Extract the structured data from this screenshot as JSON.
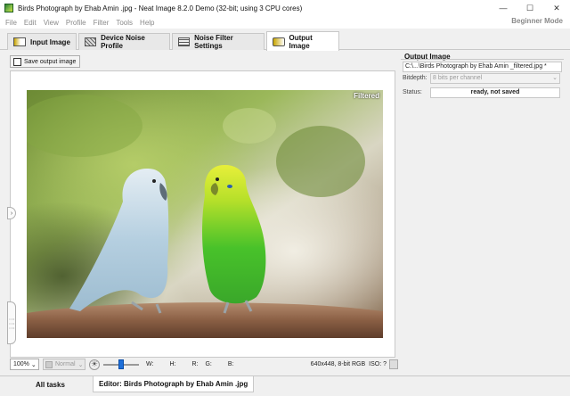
{
  "window": {
    "title": "Birds Photograph by Ehab Amin .jpg - Neat Image 8.2.0 Demo (32-bit; using 3 CPU cores)",
    "minimize_glyph": "—",
    "maximize_glyph": "☐",
    "close_glyph": "✕"
  },
  "menu": {
    "items": [
      "File",
      "Edit",
      "View",
      "Profile",
      "Filter",
      "Tools",
      "Help"
    ],
    "mode_label": "Beginner Mode"
  },
  "tabs": [
    {
      "label": "Input Image",
      "icon": "input-image-icon",
      "active": false
    },
    {
      "label": "Device Noise Profile",
      "icon": "noise-profile-icon",
      "active": false
    },
    {
      "label": "Noise Filter Settings",
      "icon": "filter-settings-icon",
      "active": false
    },
    {
      "label": "Output Image",
      "icon": "output-image-icon",
      "active": true
    }
  ],
  "left": {
    "save_button_label": "Save output image",
    "preview_overlay_label": "Filtered",
    "left_handle_glyph": "›",
    "side_handle_glyph": "⋮⋮⋮"
  },
  "statusbar": {
    "zoom": "100%",
    "zoom_chevron": "⌄",
    "blend_mode": "Normal",
    "blend_chevron": "⌄",
    "brightness_glyph": "☀",
    "brightness_level_percent": 50,
    "w_label": "W:",
    "h_label": "H:",
    "r_label": "R:",
    "g_label": "G:",
    "b_label": "B:",
    "image_info": "640x448, 8-bit RGB",
    "iso_label": "ISO: ?"
  },
  "output_panel": {
    "heading": "Output Image",
    "path": "C:\\...\\Birds Photograph by Ehab Amin _filtered.jpg *",
    "bitdepth_label": "Bitdepth:",
    "bitdepth_value": "8 bits per channel",
    "bitdepth_chevron": "⌄",
    "status_label": "Status:",
    "status_value": "ready, not saved"
  },
  "bottom_tabs": [
    {
      "label": "All tasks",
      "active": false
    },
    {
      "label": "Editor: Birds Photograph by Ehab Amin .jpg",
      "active": true
    }
  ],
  "colors": {
    "accent_blue": "#1e6fd9",
    "panel_bg": "#f0f0f0",
    "border": "#c8c8c8"
  }
}
